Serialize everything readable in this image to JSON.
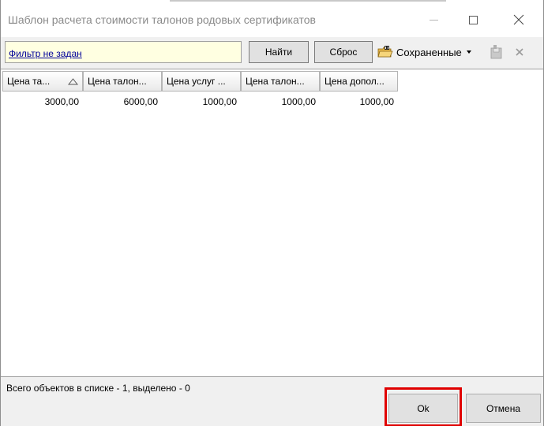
{
  "window": {
    "title": "Шаблон расчета стоимости талонов родовых сертификатов"
  },
  "toolbar": {
    "filter_text": "Фильтр не задан",
    "find_label": "Найти",
    "reset_label": "Сброс",
    "saved_label": "Сохраненные",
    "icons": [
      "folder-icon",
      "save-icon",
      "remove-icon"
    ]
  },
  "grid": {
    "columns": [
      "Цена та...",
      "Цена талон...",
      "Цена услуг ...",
      "Цена талон...",
      "Цена допол..."
    ],
    "sorted_column": 0,
    "rows": [
      [
        "3000,00",
        "6000,00",
        "1000,00",
        "1000,00",
        "1000,00"
      ]
    ]
  },
  "status": {
    "text": "Всего объектов в списке - 1, выделено - 0"
  },
  "buttons": {
    "ok_label": "Ok",
    "cancel_label": "Отмена"
  },
  "colors": {
    "highlight": "#e00000",
    "filter_background": "#ffffe1",
    "link": "#000099"
  }
}
